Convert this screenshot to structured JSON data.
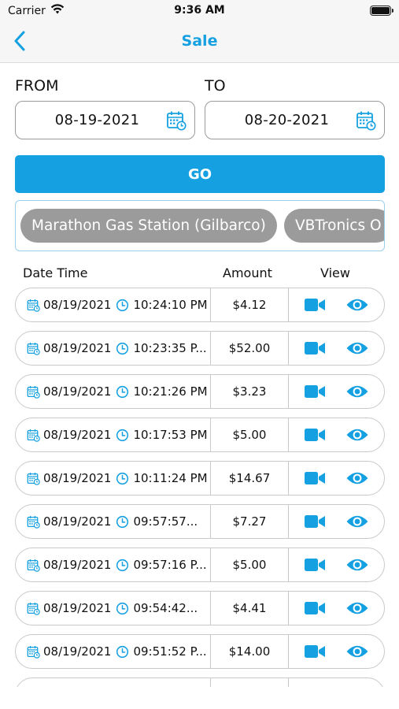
{
  "status_bar": {
    "carrier": "Carrier",
    "time": "9:36 AM"
  },
  "nav": {
    "title": "Sale"
  },
  "filters": {
    "from_label": "FROM",
    "to_label": "TO",
    "from_value": "08-19-2021",
    "to_value": "08-20-2021",
    "go_label": "GO"
  },
  "stations": [
    {
      "name": "Marathon Gas Station (Gilbarco)"
    },
    {
      "name": "VBTronics O"
    }
  ],
  "table": {
    "headers": {
      "datetime": "Date Time",
      "amount": "Amount",
      "view": "View"
    },
    "rows": [
      {
        "date": "08/19/2021",
        "time": "10:24:10 PM",
        "amount": "$4.12"
      },
      {
        "date": "08/19/2021",
        "time": "10:23:35 P...",
        "amount": "$52.00"
      },
      {
        "date": "08/19/2021",
        "time": "10:21:26 PM",
        "amount": "$3.23"
      },
      {
        "date": "08/19/2021",
        "time": "10:17:53 PM",
        "amount": "$5.00"
      },
      {
        "date": "08/19/2021",
        "time": "10:11:24 PM",
        "amount": "$14.67"
      },
      {
        "date": "08/19/2021",
        "time": "09:57:57...",
        "amount": "$7.27"
      },
      {
        "date": "08/19/2021",
        "time": "09:57:16 P...",
        "amount": "$5.00"
      },
      {
        "date": "08/19/2021",
        "time": "09:54:42...",
        "amount": "$4.41"
      },
      {
        "date": "08/19/2021",
        "time": "09:51:52 P...",
        "amount": "$14.00"
      },
      {
        "date": "",
        "time": "",
        "amount": ""
      }
    ]
  },
  "colors": {
    "accent": "#14a0e1",
    "chip": "#9b9b9b"
  },
  "icons": {
    "back": "chevron-left-icon",
    "calendar": "calendar-icon",
    "clock": "clock-icon",
    "video": "video-camera-icon",
    "view": "eye-icon"
  }
}
